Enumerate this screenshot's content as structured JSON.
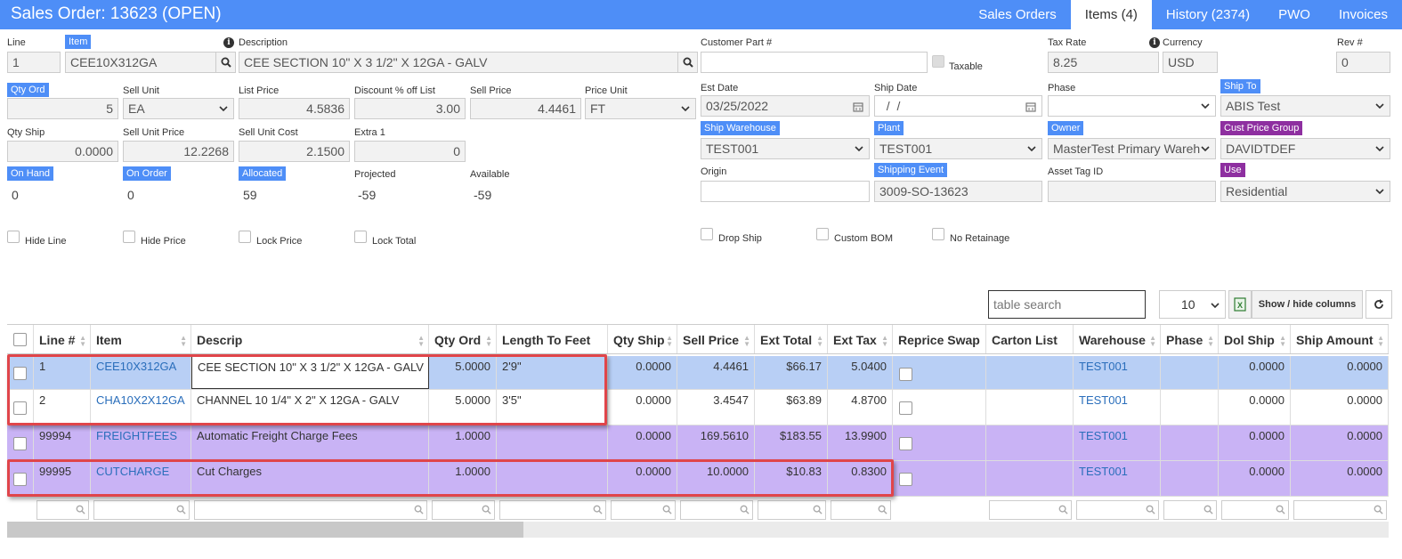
{
  "header": {
    "title": "Sales Order: 13623 (OPEN)"
  },
  "tabs": [
    {
      "label": "Sales Orders"
    },
    {
      "label": "Items (4)"
    },
    {
      "label": "History (2374)"
    },
    {
      "label": "PWO"
    },
    {
      "label": "Invoices"
    }
  ],
  "form": {
    "line": {
      "label": "Line",
      "value": "1"
    },
    "item": {
      "label": "Item",
      "value": "CEE10X312GA"
    },
    "description": {
      "label": "Description",
      "value": "CEE SECTION  10\" X 3 1/2\" X 12GA - GALV"
    },
    "customer_part": {
      "label": "Customer Part #",
      "value": ""
    },
    "taxable": {
      "label": "Taxable"
    },
    "tax_rate": {
      "label": "Tax Rate",
      "value": "8.25"
    },
    "currency": {
      "label": "Currency",
      "value": "USD"
    },
    "rev": {
      "label": "Rev #",
      "value": "0"
    },
    "qty_ord": {
      "label": "Qty Ord",
      "value": "5"
    },
    "sell_unit": {
      "label": "Sell Unit",
      "value": "EA"
    },
    "list_price": {
      "label": "List Price",
      "value": "4.5836"
    },
    "discount": {
      "label": "Discount % off List",
      "value": "3.00"
    },
    "sell_price": {
      "label": "Sell Price",
      "value": "4.4461"
    },
    "price_unit": {
      "label": "Price Unit",
      "value": "FT"
    },
    "est_date": {
      "label": "Est Date",
      "value": "03/25/2022"
    },
    "ship_date": {
      "label": "Ship Date",
      "value": "  /  /"
    },
    "phase": {
      "label": "Phase",
      "value": ""
    },
    "ship_to": {
      "label": "Ship To",
      "value": "ABIS Test"
    },
    "qty_ship": {
      "label": "Qty Ship",
      "value": "0.0000"
    },
    "sell_unit_price": {
      "label": "Sell Unit Price",
      "value": "12.2268"
    },
    "sell_unit_cost": {
      "label": "Sell Unit Cost",
      "value": "2.1500"
    },
    "extra1": {
      "label": "Extra 1",
      "value": "0"
    },
    "ship_warehouse": {
      "label": "Ship Warehouse",
      "value": "TEST001"
    },
    "plant": {
      "label": "Plant",
      "value": "TEST001"
    },
    "owner": {
      "label": "Owner",
      "value": "MasterTest Primary Wareh"
    },
    "cust_price_group": {
      "label": "Cust Price Group",
      "value": "DAVIDTDEF"
    },
    "on_hand": {
      "label": "On Hand",
      "value": "0"
    },
    "on_order": {
      "label": "On Order",
      "value": "0"
    },
    "allocated": {
      "label": "Allocated",
      "value": "59"
    },
    "projected": {
      "label": "Projected",
      "value": "-59"
    },
    "available": {
      "label": "Available",
      "value": "-59"
    },
    "origin": {
      "label": "Origin",
      "value": ""
    },
    "shipping_event": {
      "label": "Shipping Event",
      "value": "3009-SO-13623"
    },
    "asset_tag": {
      "label": "Asset Tag ID",
      "value": ""
    },
    "use": {
      "label": "Use",
      "value": "Residential"
    },
    "checkboxes": {
      "hide_line": "Hide Line",
      "hide_price": "Hide Price",
      "lock_price": "Lock Price",
      "lock_total": "Lock Total",
      "drop_ship": "Drop Ship",
      "custom_bom": "Custom BOM",
      "no_retainage": "No Retainage"
    }
  },
  "table_controls": {
    "search_placeholder": "table search",
    "page_size": "10",
    "show_hide_label": "Show / hide columns"
  },
  "table": {
    "columns": [
      "Line #",
      "Item",
      "Descrip",
      "Qty Ord",
      "Length To Feet",
      "Qty Ship",
      "Sell Price",
      "Ext Total",
      "Ext Tax",
      "Reprice Swap",
      "Carton List",
      "Warehouse",
      "Phase",
      "Dol Ship",
      "Ship Amount"
    ],
    "rows": [
      {
        "line": "1",
        "item": "CEE10X312GA",
        "descrip": "CEE SECTION 10\" X 3 1/2\" X 12GA - GALV",
        "qty_ord": "5.0000",
        "length": "2'9\"",
        "qty_ship": "0.0000",
        "sell_price": "4.4461",
        "ext_total": "$66.17",
        "ext_tax": "5.0400",
        "carton": "",
        "warehouse": "TEST001",
        "phase": "",
        "dol_ship": "0.0000",
        "ship_amount": "0.0000",
        "bg": "#b8cff5"
      },
      {
        "line": "2",
        "item": "CHA10X2X12GA",
        "descrip": "CHANNEL 10 1/4\" X 2\" X 12GA - GALV",
        "qty_ord": "5.0000",
        "length": "3'5\"",
        "qty_ship": "0.0000",
        "sell_price": "3.4547",
        "ext_total": "$63.89",
        "ext_tax": "4.8700",
        "carton": "",
        "warehouse": "TEST001",
        "phase": "",
        "dol_ship": "0.0000",
        "ship_amount": "0.0000",
        "bg": "#ffffff"
      },
      {
        "line": "99994",
        "item": "FREIGHTFEES",
        "descrip": "Automatic Freight Charge Fees",
        "qty_ord": "1.0000",
        "length": "",
        "qty_ship": "0.0000",
        "sell_price": "169.5610",
        "ext_total": "$183.55",
        "ext_tax": "13.9900",
        "carton": "",
        "warehouse": "TEST001",
        "phase": "",
        "dol_ship": "0.0000",
        "ship_amount": "0.0000",
        "bg": "#c9b3f5"
      },
      {
        "line": "99995",
        "item": "CUTCHARGE",
        "descrip": "Cut Charges",
        "qty_ord": "1.0000",
        "length": "",
        "qty_ship": "0.0000",
        "sell_price": "10.0000",
        "ext_total": "$10.83",
        "ext_tax": "0.8300",
        "carton": "",
        "warehouse": "TEST001",
        "phase": "",
        "dol_ship": "0.0000",
        "ship_amount": "0.0000",
        "bg": "#c9b3f5"
      }
    ]
  },
  "colors": {
    "accent": "#4e8ef7",
    "purple_tag": "#8e2fa0",
    "highlight": "#e0454a"
  }
}
